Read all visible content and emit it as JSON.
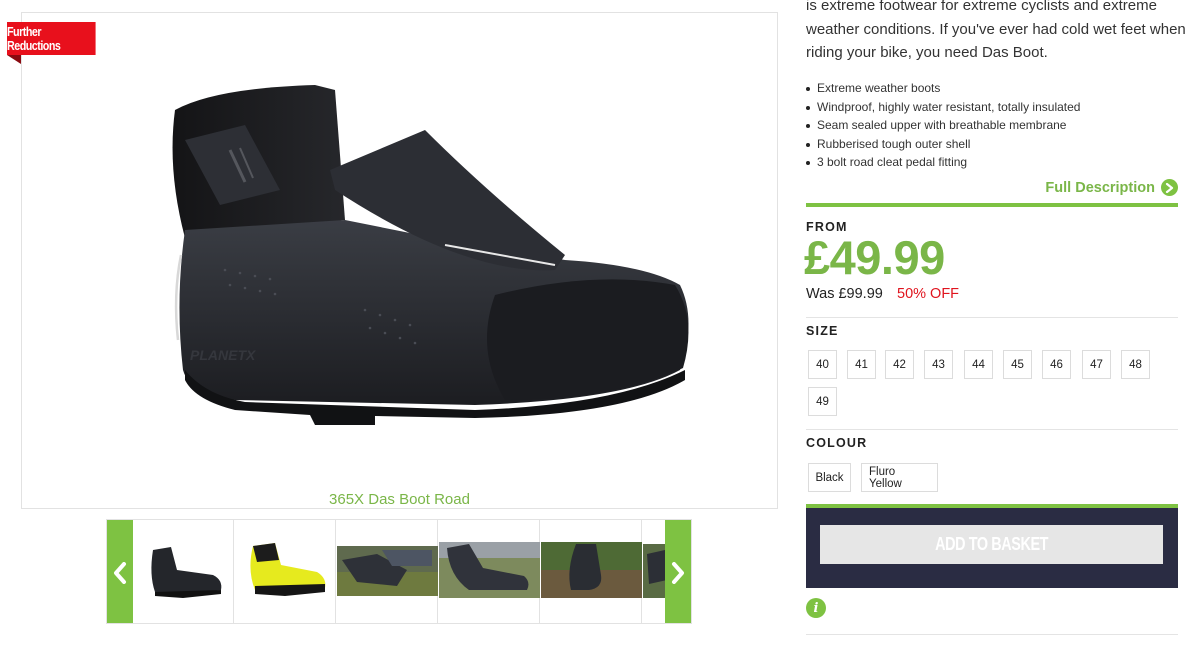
{
  "product": {
    "badge": "Further Reductions",
    "caption": "365X Das Boot Road",
    "description": "is extreme footwear for extreme cyclists and extreme weather conditions. If you've ever had cold wet feet when riding your bike, you need Das Boot.",
    "features": [
      "Extreme weather boots",
      "Windproof, highly water resistant, totally insulated",
      "Seam sealed upper with breathable membrane",
      "Rubberised tough outer shell",
      "3 bolt road cleat pedal fitting"
    ],
    "full_description_link": "Full Description",
    "brand_mark": "PLANETX"
  },
  "pricing": {
    "from_label": "FROM",
    "price": "£49.99",
    "was": "Was £99.99",
    "discount": "50% OFF"
  },
  "size": {
    "label": "SIZE",
    "options": [
      "40",
      "41",
      "42",
      "43",
      "44",
      "45",
      "46",
      "47",
      "48",
      "49"
    ]
  },
  "colour": {
    "label": "COLOUR",
    "options": [
      "Black",
      "Fluro Yellow"
    ]
  },
  "basket": {
    "button_label": "ADD TO BASKET"
  },
  "thumbnails": [
    {
      "name": "thumb-black-boot"
    },
    {
      "name": "thumb-yellow-boot"
    },
    {
      "name": "thumb-riding-photo-1"
    },
    {
      "name": "thumb-riding-photo-2"
    },
    {
      "name": "thumb-riding-photo-3"
    },
    {
      "name": "thumb-riding-photo-4"
    }
  ],
  "icons": {
    "carousel_prev": "chevron-left-icon",
    "carousel_next": "chevron-right-icon",
    "full_description": "chevron-circle-right-icon",
    "info": "info-icon"
  },
  "colors": {
    "accent_green": "#7ec242",
    "price_green": "#7ab648",
    "discount_red": "#e0141e",
    "badge_red": "#e8101c",
    "basket_panel": "#2a2c43"
  }
}
